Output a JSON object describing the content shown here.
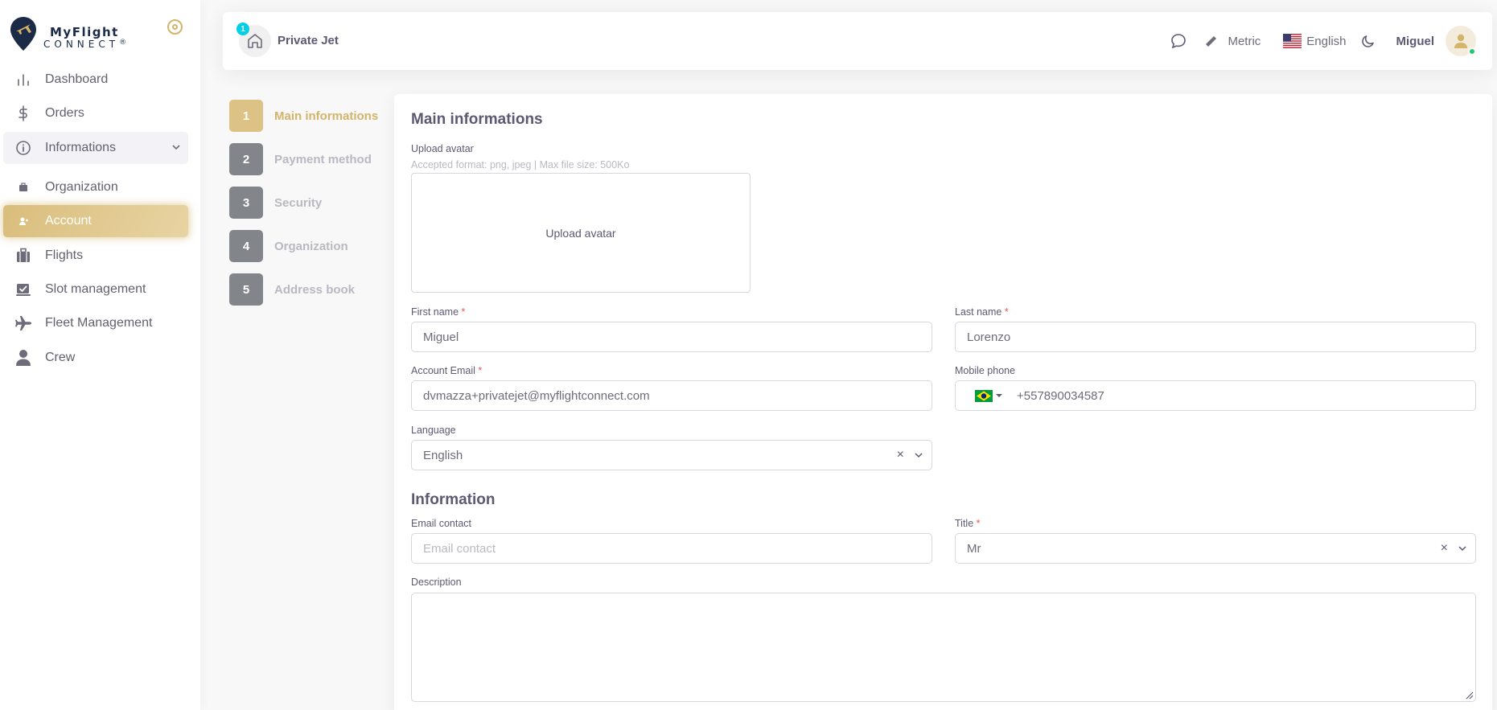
{
  "brand": {
    "name": "MyFlight",
    "sub": "CONNECT",
    "mark": "®"
  },
  "sidebar": {
    "items": [
      {
        "label": "Dashboard",
        "icon": "bar-chart-icon"
      },
      {
        "label": "Orders",
        "icon": "dollar-icon"
      },
      {
        "label": "Informations",
        "icon": "info-circle-icon",
        "expanded": true
      },
      {
        "label": "Organization",
        "icon": "briefcase-icon"
      },
      {
        "label": "Account",
        "icon": "user-small-icon",
        "active": true
      },
      {
        "label": "Flights",
        "icon": "suitcase-icon"
      },
      {
        "label": "Slot management",
        "icon": "calendar-check-icon"
      },
      {
        "label": "Fleet Management",
        "icon": "plane-icon"
      },
      {
        "label": "Crew",
        "icon": "person-icon"
      }
    ]
  },
  "navbar": {
    "badge": "1",
    "org_name": "Private Jet",
    "units": "Metric",
    "language": "English",
    "user_name": "Miguel"
  },
  "stepper": [
    {
      "num": "1",
      "label": "Main informations"
    },
    {
      "num": "2",
      "label": "Payment method"
    },
    {
      "num": "3",
      "label": "Security"
    },
    {
      "num": "4",
      "label": "Organization"
    },
    {
      "num": "5",
      "label": "Address book"
    }
  ],
  "form": {
    "title": "Main informations",
    "upload_label": "Upload avatar",
    "upload_hint": "Accepted format: png, jpeg | Max file size: 500Ko",
    "upload_button": "Upload avatar",
    "first_name_label": "First name",
    "first_name": "Miguel",
    "last_name_label": "Last name",
    "last_name": "Lorenzo",
    "email_label": "Account Email",
    "email": "dvmazza+privatejet@myflightconnect.com",
    "mobile_label": "Mobile phone",
    "mobile": "+557890034587",
    "language_label": "Language",
    "language": "English",
    "required_mark": "*",
    "info_title": "Information",
    "email_contact_label": "Email contact",
    "email_contact_placeholder": "Email contact",
    "title_label": "Title",
    "title_value": "Mr",
    "description_label": "Description",
    "clear_symbol": "×"
  },
  "colors": {
    "accent": "#d4b36a",
    "accent_light": "#e8d4a3",
    "badge": "#00cfe8",
    "online": "#28c76f"
  }
}
